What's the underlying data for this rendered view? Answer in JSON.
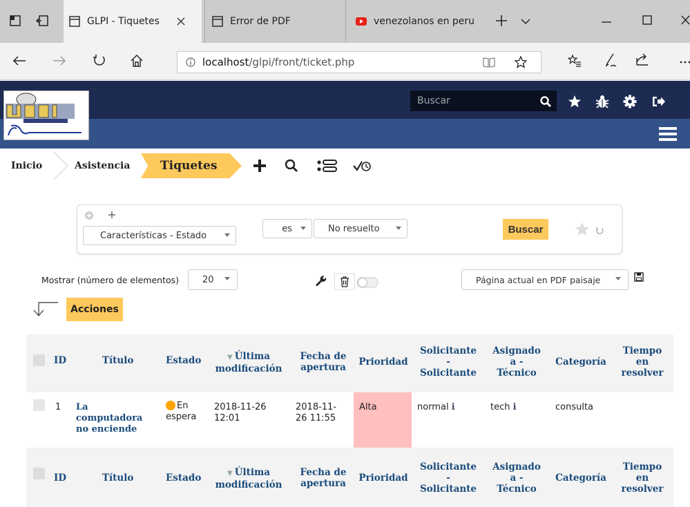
{
  "browser": {
    "tabs": [
      {
        "title": "GLPI - Tiquetes"
      },
      {
        "title": "Error de PDF"
      },
      {
        "title": "venezolanos en peru"
      }
    ],
    "url_host": "localhost",
    "url_path": "/glpi/front/ticket.php"
  },
  "header": {
    "search_placeholder": "Buscar"
  },
  "breadcrumb": {
    "home": "Inicio",
    "assist": "Asistencia",
    "current": "Tiquetes"
  },
  "search": {
    "criteria_field": "Características - Estado",
    "operator": "es",
    "value": "No resuelto",
    "search_button": "Buscar"
  },
  "controls": {
    "show_label": "Mostrar (número de elementos)",
    "per_page": "20",
    "export_option": "Página actual en PDF paisaje",
    "actions_button": "Acciones"
  },
  "table": {
    "columns": {
      "id": "ID",
      "title": "Título",
      "status": "Estado",
      "lastmod_1": "Última",
      "lastmod_2": "modificación",
      "opened_1": "Fecha de",
      "opened_2": "apertura",
      "priority": "Prioridad",
      "req_1": "Solicitante",
      "req_2": "-",
      "req_3": "Solicitante",
      "asg_1": "Asignado",
      "asg_2": "a -",
      "asg_3": "Técnico",
      "category": "Categoría",
      "ttr_1": "Tiempo",
      "ttr_2": "en",
      "ttr_3": "resolver"
    },
    "rows": [
      {
        "id": "1",
        "title_1": "La",
        "title_2": "computadora",
        "title_3": "no enciende",
        "status_1": "En",
        "status_2": "espera",
        "lastmod_1": "2018-11-26",
        "lastmod_2": "12:01",
        "opened_1": "2018-11-",
        "opened_2": "26 11:55",
        "priority": "Alta",
        "requester": "normal",
        "assigned": "tech",
        "category": "consulta"
      }
    ]
  },
  "colors": {
    "header_dark": "#1d2b52",
    "header_band": "#34528a",
    "accent": "#fec95c",
    "priority_high": "#ffbfbf",
    "status_waiting": "#ffa500"
  }
}
